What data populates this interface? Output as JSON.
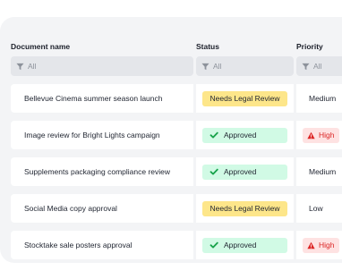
{
  "table": {
    "columns": [
      {
        "key": "name",
        "label": "Document name",
        "filter": "All"
      },
      {
        "key": "status",
        "label": "Status",
        "filter": "All"
      },
      {
        "key": "priority",
        "label": "Priority",
        "filter": "All"
      }
    ],
    "rows": [
      {
        "name": "Bellevue Cinema summer season launch",
        "status": "Needs Legal Review",
        "status_type": "review",
        "priority": "Medium",
        "priority_type": "normal"
      },
      {
        "name": "Image review for Bright Lights campaign",
        "status": "Approved",
        "status_type": "approved",
        "priority": "High",
        "priority_type": "high"
      },
      {
        "name": "Supplements packaging compliance review",
        "status": "Approved",
        "status_type": "approved",
        "priority": "Medium",
        "priority_type": "normal"
      },
      {
        "name": "Social Media copy approval",
        "status": "Needs Legal Review",
        "status_type": "review",
        "priority": "Low",
        "priority_type": "normal"
      },
      {
        "name": "Stocktake sale posters approval",
        "status": "Approved",
        "status_type": "approved",
        "priority": "High",
        "priority_type": "high"
      }
    ]
  },
  "icons": {
    "filter": "filter-funnel-icon",
    "approved": "check-icon",
    "high_priority": "warning-triangle-icon"
  },
  "colors": {
    "card_background": "#f3f4f6",
    "filter_background": "#e4e6ea",
    "review_badge": "#fde68a",
    "approved_badge": "#d1fae5",
    "approved_check": "#16a34a",
    "high_badge": "#fee2e2",
    "high_text": "#dc2626"
  }
}
